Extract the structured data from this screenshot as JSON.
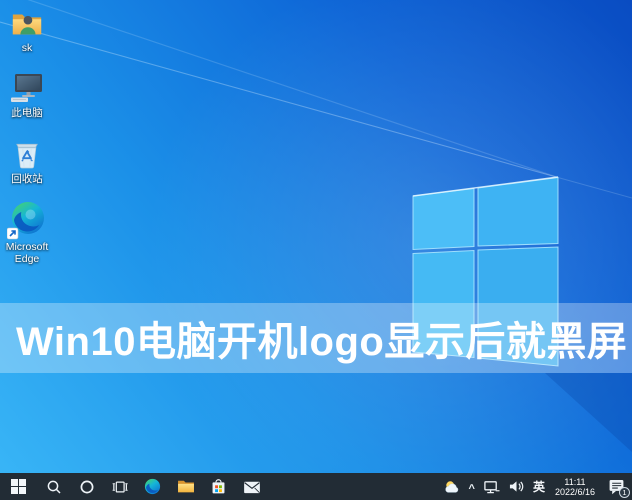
{
  "banner": {
    "title": "Win10电脑开机logo显示后就黑屏"
  },
  "desktop": {
    "icons": [
      {
        "id": "user-folder",
        "label": "sk"
      },
      {
        "id": "this-pc",
        "label": "此电脑"
      },
      {
        "id": "recycle-bin",
        "label": "回收站"
      },
      {
        "id": "microsoft-edge",
        "label": "Microsoft Edge"
      }
    ]
  },
  "taskbar": {
    "icons": [
      "start",
      "search",
      "cortana",
      "task-view",
      "edge",
      "file-explorer",
      "microsoft-store",
      "mail"
    ],
    "tray": {
      "weather_icon": "partly-cloudy",
      "chevron": "^",
      "network_icon": "wired-network",
      "volume_icon": "speaker",
      "ime": "英",
      "time": "11:11",
      "date": "2022/6/16",
      "notifications_badge": "1"
    }
  },
  "colors": {
    "taskbar_bg": "#222c35",
    "banner_overlay": "rgba(255,255,255,0.30)",
    "wallpaper_light": "#3ab7f7",
    "wallpaper_dark": "#0a4cc2",
    "headline_text": "#ffffff"
  }
}
